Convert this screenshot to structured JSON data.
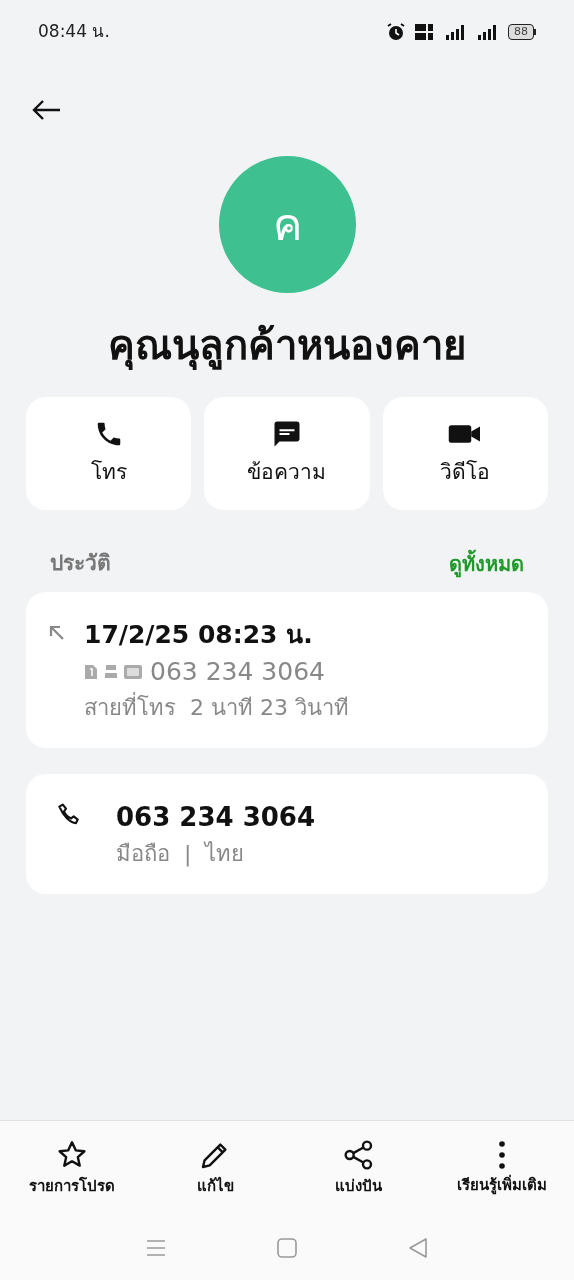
{
  "status_bar": {
    "time": "08:44 น.",
    "battery": "88"
  },
  "contact": {
    "initial": "ค",
    "name": "คุณนุลูกค้าหนองคาย"
  },
  "actions": [
    {
      "kind": "call",
      "label": "โทร"
    },
    {
      "kind": "message",
      "label": "ข้อความ"
    },
    {
      "kind": "video",
      "label": "วิดีโอ"
    }
  ],
  "history": {
    "title": "ประวัติ",
    "link": "ดูทั้งหมด",
    "entry": {
      "datetime": "17/2/25 08:23 น.",
      "number": "063 234 3064",
      "duration": "สายที่โทร  2 นาที 23 วินาที"
    }
  },
  "phone": {
    "number": "063 234 3064",
    "type": "มือถือ",
    "separator": "|",
    "region": "ไทย"
  },
  "bottom_actions": [
    {
      "kind": "favorite",
      "label": "รายการโปรด"
    },
    {
      "kind": "edit",
      "label": "แก้ไข"
    },
    {
      "kind": "share",
      "label": "แบ่งปัน"
    },
    {
      "kind": "more",
      "label": "เรียนรู้เพิ่มเติม"
    }
  ]
}
